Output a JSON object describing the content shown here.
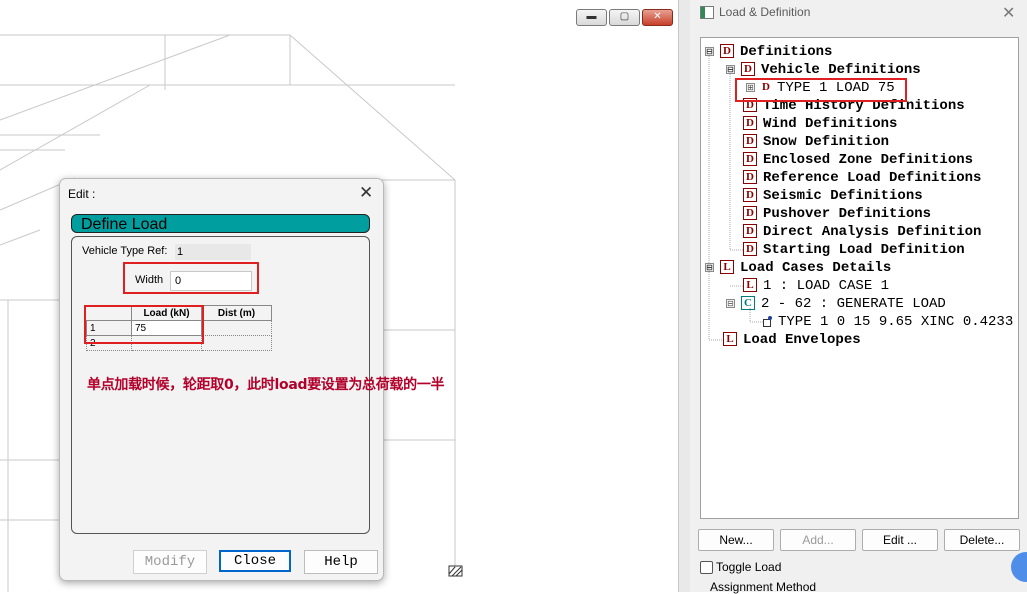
{
  "window_buttons": {
    "minimize": "▬",
    "restore": "▢",
    "close": "✕"
  },
  "panel": {
    "title": "Load & Definition",
    "close": "✕",
    "tree": [
      {
        "badge": "D",
        "expander": "⊟",
        "label": "Definitions"
      },
      {
        "badge": "D",
        "expander": "⊟",
        "label": "Vehicle Definitions"
      },
      {
        "badge": "D",
        "expander": "⊞",
        "label": "TYPE 1 LOAD 75"
      },
      {
        "badge": "D",
        "label": "Time History Definitions"
      },
      {
        "badge": "D",
        "label": "Wind Definitions"
      },
      {
        "badge": "D",
        "label": "Snow Definition"
      },
      {
        "badge": "D",
        "label": "Enclosed Zone Definitions"
      },
      {
        "badge": "D",
        "label": "Reference Load Definitions"
      },
      {
        "badge": "D",
        "label": "Seismic Definitions"
      },
      {
        "badge": "D",
        "label": "Pushover Definitions"
      },
      {
        "badge": "D",
        "label": "Direct Analysis Definition"
      },
      {
        "badge": "D",
        "label": "Starting Load Definition"
      },
      {
        "badge": "L",
        "expander": "⊟",
        "label": "Load Cases Details"
      },
      {
        "badge": "L",
        "label": "1 : LOAD CASE 1"
      },
      {
        "badge": "C",
        "expander": "⊟",
        "label": "2 - 62 : GENERATE LOAD"
      },
      {
        "label": "TYPE 1 0 15 9.65 XINC 0.4233"
      },
      {
        "badge": "L",
        "label": "Load Envelopes"
      }
    ],
    "buttons": {
      "new": "New...",
      "add": "Add...",
      "edit": "Edit ...",
      "delete": "Delete..."
    },
    "toggle_load": "Toggle Load",
    "assignment_method": "Assignment Method"
  },
  "dialog": {
    "title": "Edit :",
    "close": "✕",
    "header": "Define Load",
    "vehicle_type_ref_label": "Vehicle Type Ref:",
    "vehicle_type_ref_value": "1",
    "width_label": "Width",
    "width_value": "0",
    "grid": {
      "columns": [
        "Load (kN)",
        "Dist (m)"
      ],
      "rows": [
        {
          "num": "1",
          "load": "75",
          "dist": ""
        },
        {
          "num": "2",
          "load": "",
          "dist": ""
        }
      ]
    },
    "note": "单点加载时候，轮距取0，此时load要设置为总荷载的一半",
    "buttons": {
      "modify": "Modify",
      "close": "Close",
      "help": "Help"
    }
  },
  "colors": {
    "accent_teal": "#009e9e",
    "highlight_red": "#e02020",
    "note_red": "#b2002a",
    "badge_red": "#8b0000"
  }
}
